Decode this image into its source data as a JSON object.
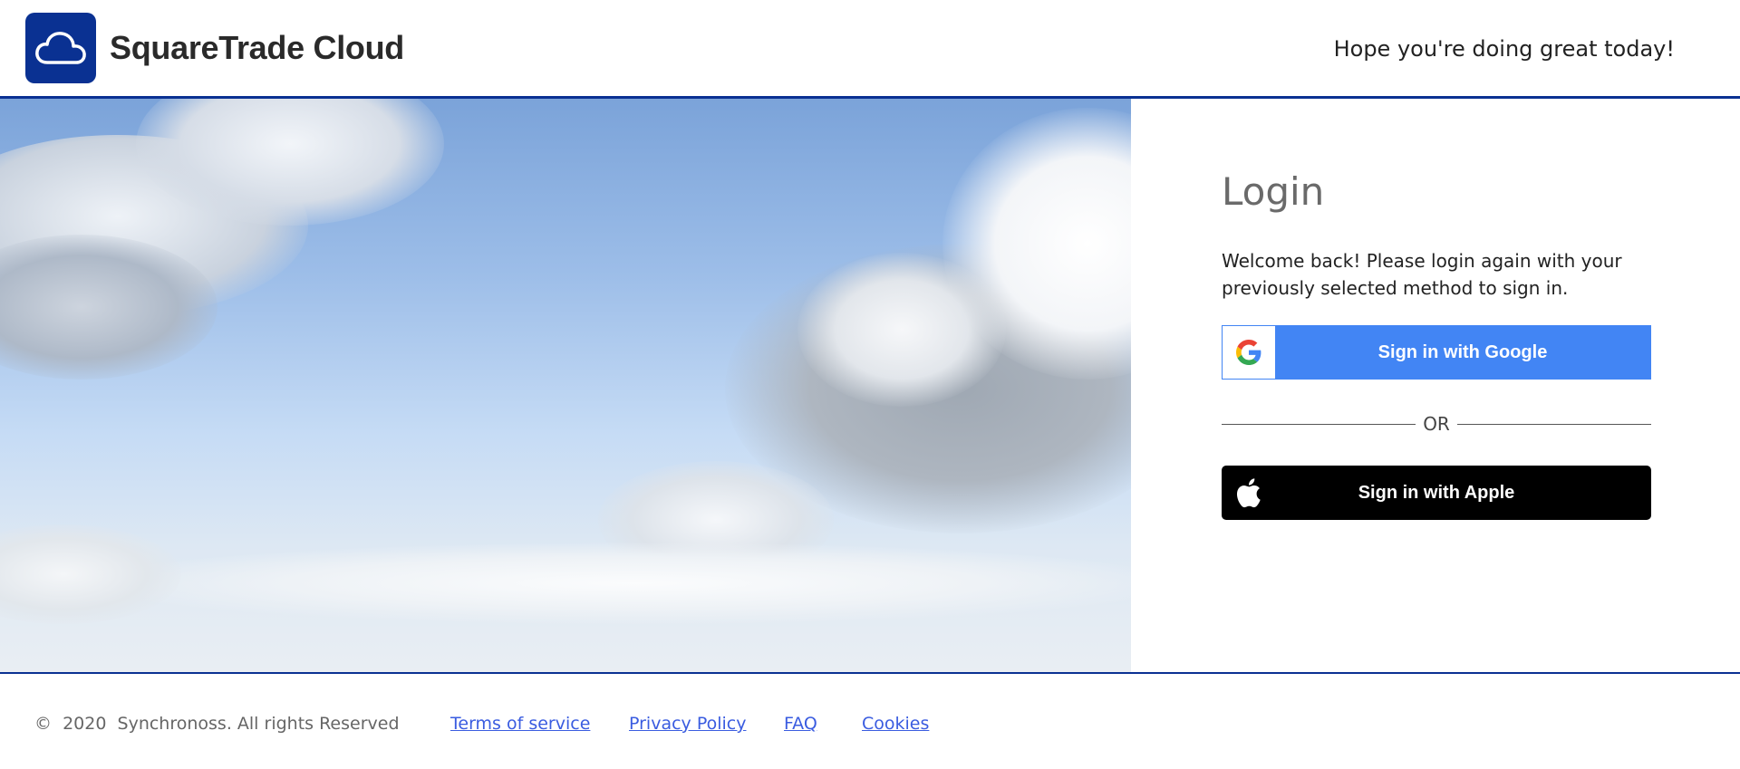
{
  "header": {
    "brand": "SquareTrade Cloud",
    "greeting": "Hope you're doing great today!",
    "logo_icon": "cloud-icon"
  },
  "login": {
    "title": "Login",
    "description": "Welcome back! Please login again with your previously selected method to sign in.",
    "google_button_label": "Sign in with Google",
    "google_icon": "google-g-icon",
    "divider_text": "OR",
    "apple_button_label": "Sign in with Apple",
    "apple_icon": "apple-icon"
  },
  "footer": {
    "copyright": "©  2020  Synchronoss. All rights Reserved",
    "links": [
      "Terms of service",
      "Privacy Policy",
      "FAQ",
      "Cookies"
    ]
  },
  "colors": {
    "brand_blue": "#0a3192",
    "google_blue": "#4285f4",
    "apple_black": "#000000",
    "link_blue": "#3a5ce0"
  }
}
